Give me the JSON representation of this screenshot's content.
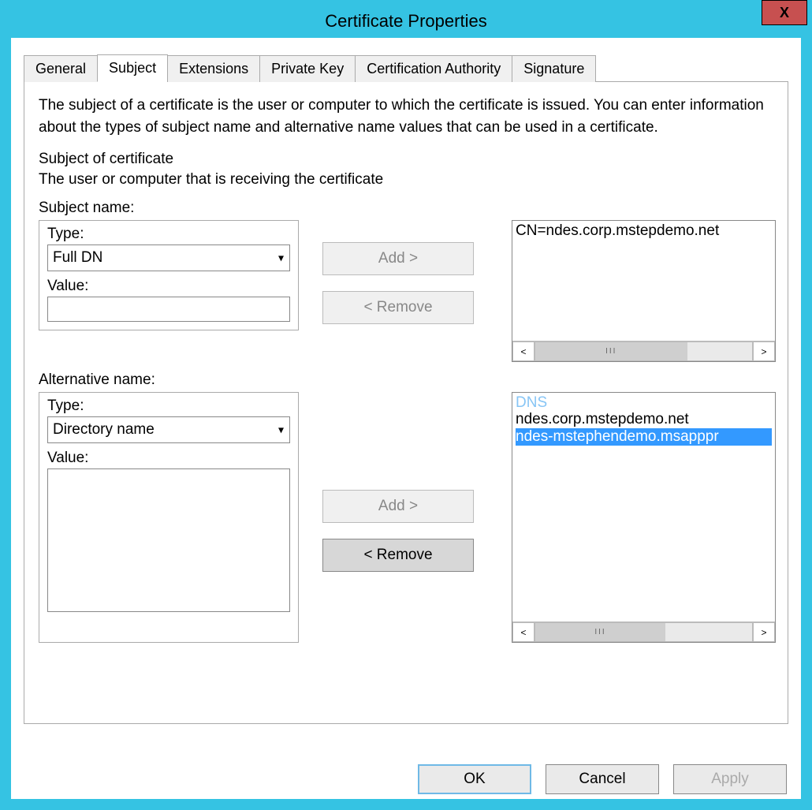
{
  "window": {
    "title": "Certificate Properties",
    "close_glyph": "X"
  },
  "tabs": [
    "General",
    "Subject",
    "Extensions",
    "Private Key",
    "Certification Authority",
    "Signature"
  ],
  "active_tab": "Subject",
  "subject": {
    "description": "The subject of a certificate is the user or computer to which the certificate is issued. You can enter information about the types of subject name and alternative name values that can be used in a certificate.",
    "heading": "Subject of certificate",
    "subheading": "The user or computer that is receiving the certificate",
    "subject_name_label": "Subject name:",
    "alt_name_label": "Alternative name:",
    "type_label": "Type:",
    "value_label": "Value:",
    "type_select_sn": "Full DN",
    "value_sn": "",
    "type_select_an": "Directory name",
    "value_an": "",
    "add_label": "Add >",
    "remove_label": "< Remove",
    "sn_list": [
      "CN=ndes.corp.mstepdemo.net"
    ],
    "an_list_category": "DNS",
    "an_list": [
      "ndes.corp.mstepdemo.net",
      "ndes-mstephendemo.msapppr"
    ],
    "an_selected_index": 1
  },
  "buttons": {
    "ok": "OK",
    "cancel": "Cancel",
    "apply": "Apply"
  },
  "glyphs": {
    "caret": "▾",
    "left": "<",
    "right": ">",
    "grip": "III"
  }
}
